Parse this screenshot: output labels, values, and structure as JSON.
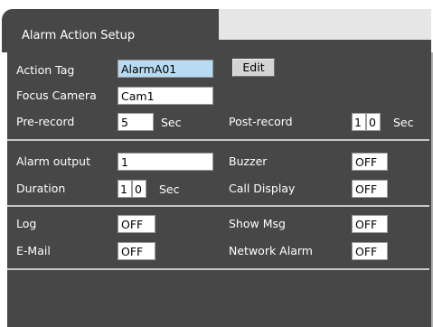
{
  "tab": {
    "title": "Alarm Action Setup"
  },
  "section1": {
    "action_tag_label": "Action Tag",
    "action_tag_value": "AlarmA01",
    "edit_label": "Edit",
    "focus_camera_label": "Focus Camera",
    "focus_camera_value": "Cam1",
    "pre_record_label": "Pre-record",
    "pre_record_value": "5",
    "pre_record_unit": "Sec",
    "post_record_label": "Post-record",
    "post_record_digit1": "1",
    "post_record_digit2": "0",
    "post_record_unit": "Sec"
  },
  "section2": {
    "alarm_output_label": "Alarm output",
    "alarm_output_value": "1",
    "buzzer_label": "Buzzer",
    "buzzer_value": "OFF",
    "duration_label": "Duration",
    "duration_digit1": "1",
    "duration_digit2": "0",
    "duration_unit": "Sec",
    "call_display_label": "Call Display",
    "call_display_value": "OFF"
  },
  "section3": {
    "log_label": "Log",
    "log_value": "OFF",
    "show_msg_label": "Show Msg",
    "show_msg_value": "OFF",
    "email_label": "E-Mail",
    "email_value": "OFF",
    "network_alarm_label": "Network Alarm",
    "network_alarm_value": "OFF"
  }
}
